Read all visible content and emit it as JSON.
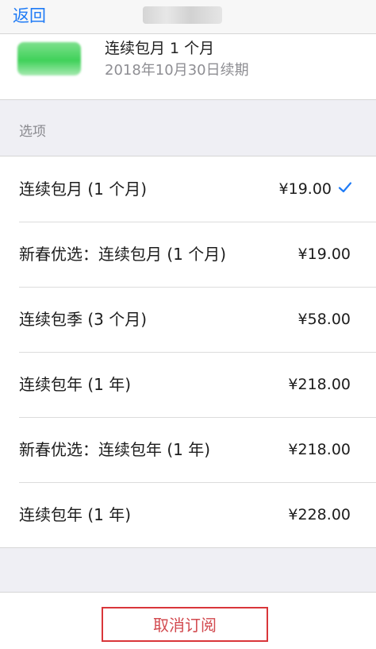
{
  "navbar": {
    "back_label": "返回"
  },
  "subscription": {
    "plan_name": "连续包月 1 个月",
    "renewal_date": "2018年10月30日续期"
  },
  "options": {
    "section_label": "选项",
    "items": [
      {
        "name": "连续包月 (1 个月)",
        "price": "¥19.00",
        "selected": true
      },
      {
        "name": "新春优选：连续包月 (1 个月)",
        "price": "¥19.00",
        "selected": false
      },
      {
        "name": "连续包季 (3 个月)",
        "price": "¥58.00",
        "selected": false
      },
      {
        "name": "连续包年 (1 年)",
        "price": "¥218.00",
        "selected": false
      },
      {
        "name": "新春优选：连续包年 (1 年)",
        "price": "¥218.00",
        "selected": false
      },
      {
        "name": "连续包年 (1 年)",
        "price": "¥228.00",
        "selected": false
      }
    ]
  },
  "footer": {
    "cancel_label": "取消订阅"
  },
  "colors": {
    "accent": "#1f7bf6",
    "destructive": "#d9363a",
    "background": "#efeff4"
  },
  "icons": {
    "selected_option": "checkmark-icon"
  }
}
